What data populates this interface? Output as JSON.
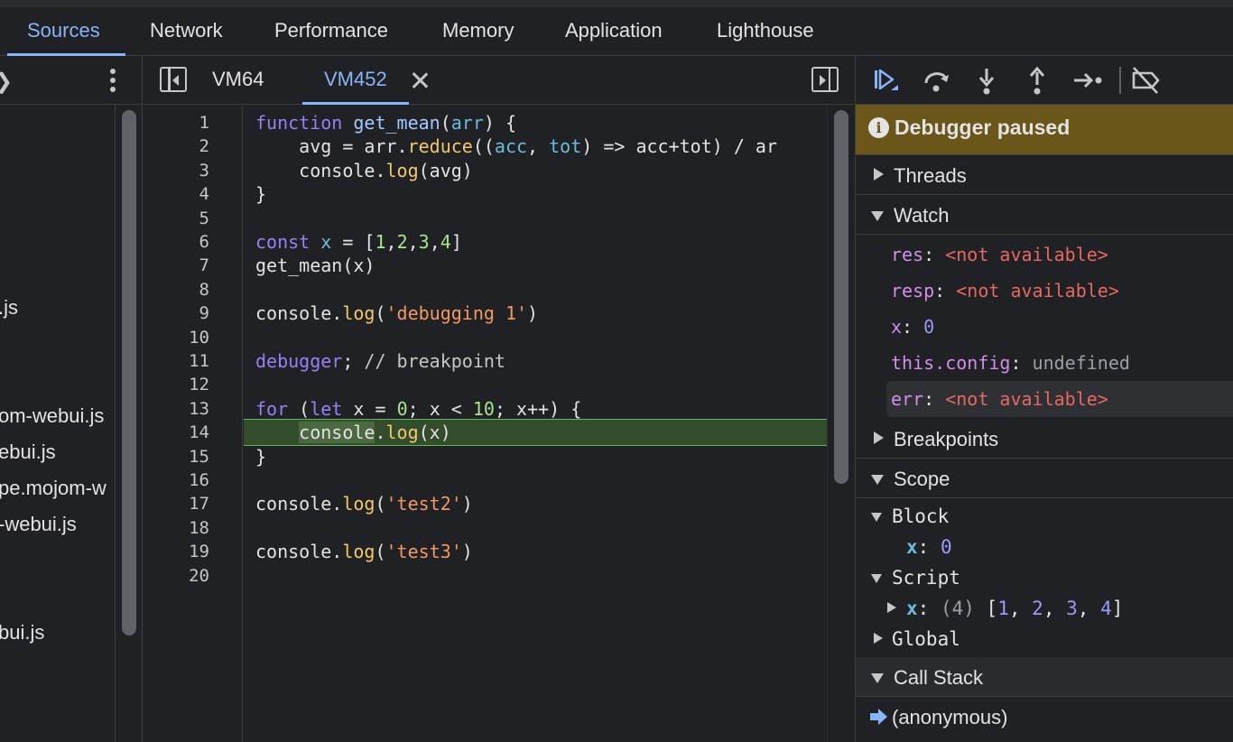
{
  "top_tabs": [
    {
      "label": "Sources",
      "active": true
    },
    {
      "label": "Network"
    },
    {
      "label": "Performance"
    },
    {
      "label": "Memory"
    },
    {
      "label": "Application"
    },
    {
      "label": "Lighthouse"
    }
  ],
  "navigator": {
    "files": [
      ".js",
      "om-webui.js",
      "ebui.js",
      "pe.mojom-w",
      "-webui.js",
      "bui.js"
    ]
  },
  "editor": {
    "tabs": [
      {
        "label": "VM64"
      },
      {
        "label": "VM452",
        "active": true,
        "closable": true
      }
    ],
    "line_numbers": [
      "1",
      "2",
      "3",
      "4",
      "5",
      "6",
      "7",
      "8",
      "9",
      "10",
      "11",
      "12",
      "13",
      "14",
      "15",
      "16",
      "17",
      "18",
      "19",
      "20"
    ],
    "lines": [
      "function get_mean(arr) {",
      "    avg = arr.reduce((acc, tot) => acc+tot) / ar",
      "    console.log(avg)",
      "}",
      "",
      "const x = [1,2,3,4]",
      "get_mean(x)",
      "",
      "console.log('debugging 1')",
      "",
      "debugger; // breakpoint",
      "",
      "for (let x = 0; x < 10; x++) {",
      "    console.log(x)",
      "}",
      "",
      "console.log('test2')",
      "",
      "console.log('test3')",
      ""
    ],
    "paused_line": 14
  },
  "debugger": {
    "toolbar_icons": [
      "resume-icon",
      "step-over-icon",
      "step-into-icon",
      "step-out-icon",
      "step-icon",
      "deactivate-breakpoints-icon"
    ],
    "paused_banner": "Debugger paused",
    "sections": {
      "threads": "Threads",
      "watch": "Watch",
      "breakpoints": "Breakpoints",
      "scope": "Scope",
      "call_stack": "Call Stack"
    },
    "watch": [
      {
        "name": "res",
        "value": "<not available>",
        "kind": "na"
      },
      {
        "name": "resp",
        "value": "<not available>",
        "kind": "na"
      },
      {
        "name": "x",
        "value": "0",
        "kind": "num"
      },
      {
        "name": "this.config",
        "value": "undefined",
        "kind": "undef"
      },
      {
        "name": "err",
        "value": "<not available>",
        "kind": "na",
        "selected": true
      }
    ],
    "scope": {
      "block_label": "Block",
      "block_var": {
        "name": "x",
        "value": "0"
      },
      "script_label": "Script",
      "script_var": {
        "name": "x",
        "count": "(4)",
        "open": "[",
        "items": [
          "1",
          "2",
          "3",
          "4"
        ],
        "close": "]"
      },
      "global_label": "Global"
    },
    "call_stack": [
      "(anonymous)"
    ]
  },
  "colors": {
    "accent": "#8ab4f8",
    "paused_banner_bg": "#6b5619",
    "exec_line_bg": "#334c2c",
    "exec_line_border": "#5bb85b"
  }
}
